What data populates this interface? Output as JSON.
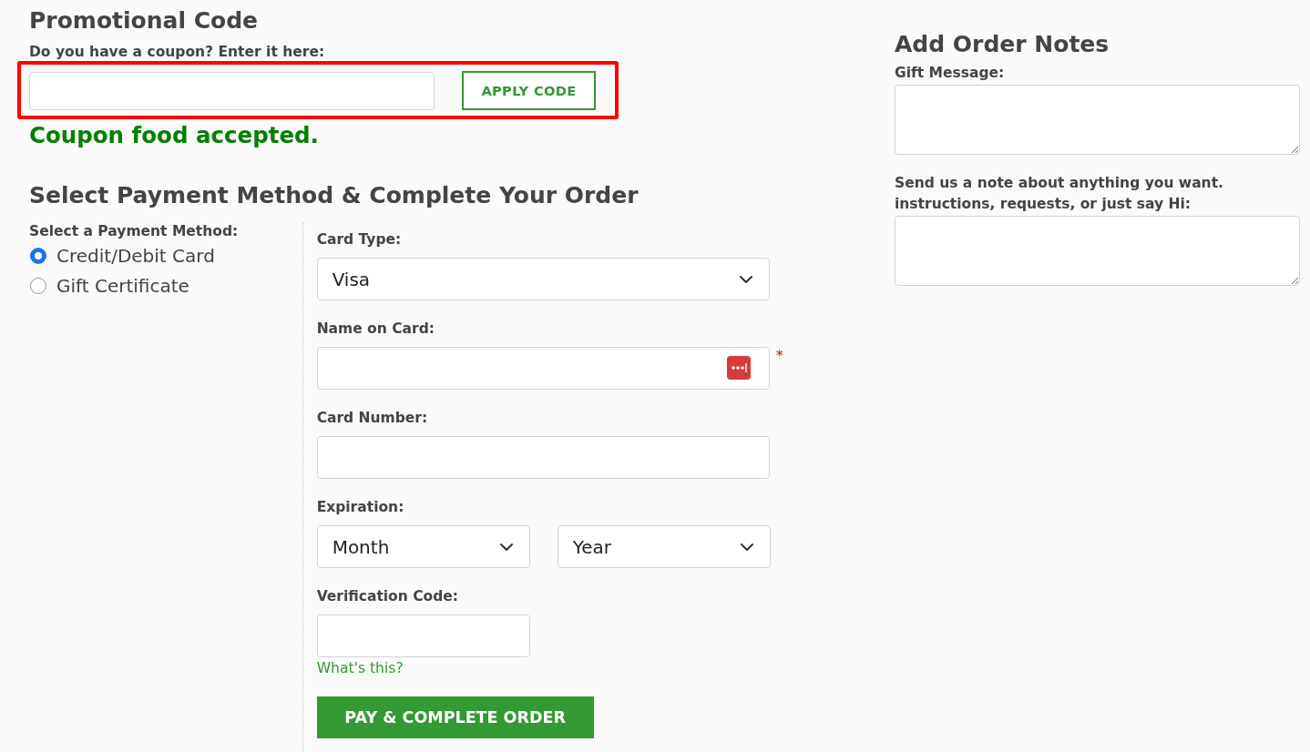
{
  "promo": {
    "title": "Promotional Code",
    "prompt": "Do you have a coupon? Enter it here:",
    "highlighted": true,
    "button": "APPLY CODE",
    "message": "Coupon food accepted."
  },
  "payment": {
    "title": "Select Payment Method & Complete Your Order",
    "method_label": "Select a Payment Method:",
    "methods": [
      {
        "label": "Credit/Debit Card",
        "selected": true
      },
      {
        "label": "Gift Certificate",
        "selected": false
      }
    ],
    "fields": [
      {
        "kind": "select",
        "label": "Card Type:",
        "values": [
          "Visa"
        ]
      },
      {
        "kind": "text",
        "label": "Name on Card:",
        "autofill_icon": true,
        "required_mark": "*"
      },
      {
        "kind": "text",
        "label": "Card Number:"
      },
      {
        "kind": "select",
        "label": "Expiration:",
        "values": [
          "Month",
          "Year"
        ]
      },
      {
        "kind": "short_text",
        "label": "Verification Code:",
        "help_link": "What's this?"
      }
    ],
    "submit": "PAY & COMPLETE ORDER"
  },
  "notes": {
    "title": "Add Order Notes",
    "fields": [
      {
        "label_lines": [
          "Gift Message:"
        ]
      },
      {
        "label_lines": [
          "Send us a note about anything you want.",
          "instructions, requests, or just say Hi:"
        ]
      }
    ]
  }
}
